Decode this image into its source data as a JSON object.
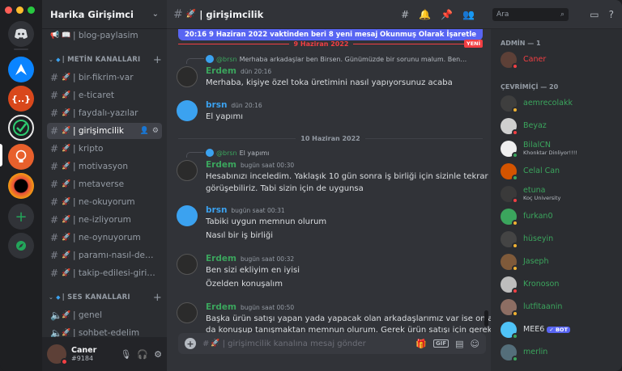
{
  "colors": {
    "accent": "#5865f2",
    "online": "#3ba55d",
    "dnd": "#f23f43",
    "idle": "#f0b232"
  },
  "guild": {
    "name": "Harika Girişimci"
  },
  "sidebar": {
    "top_channel": "| blog-paylasim",
    "text_category": "| METİN KANALLARI",
    "text_channels": [
      {
        "name": "| bir-fikrim-var"
      },
      {
        "name": "| e-ticaret"
      },
      {
        "name": "| faydalı-yazılar"
      },
      {
        "name": "| girişimcilik"
      },
      {
        "name": "| kripto"
      },
      {
        "name": "| motivasyon"
      },
      {
        "name": "| metaverse"
      },
      {
        "name": "| ne-okuyorum"
      },
      {
        "name": "| ne-izliyorum"
      },
      {
        "name": "| ne-oynuyorum"
      },
      {
        "name": "| paramı-nasıl-değe…"
      },
      {
        "name": "| takip-edilesi-girişi…"
      }
    ],
    "voice_category": "| SES KANALLARI",
    "voice_channels": [
      {
        "name": "| genel"
      },
      {
        "name": "| sohbet-edelim"
      }
    ]
  },
  "user": {
    "name": "Caner",
    "tag": "#9184"
  },
  "header": {
    "channel": "| girişimcilik",
    "search_placeholder": "Ara"
  },
  "new_messages": {
    "text": "20:16 9 Haziran 2022 vaktinden beri 8 yeni mesaj",
    "action": "Okunmuş Olarak İşaretle"
  },
  "dividers": {
    "first": "9 Haziran 2022",
    "second": "10 Haziran 2022",
    "new_label": "YENİ"
  },
  "messages": [
    {
      "reply_author": "@brsn",
      "reply_text": "Merhaba arkadaşlar ben Birsen. Günümüzde bir sorunu malum. Ben…",
      "author": "Erdem",
      "time": "dün 20:16",
      "lines": [
        "Merhaba, kişiye özel toka üretimini nasıl yapıyorsunuz acaba"
      ]
    },
    {
      "author": "brsn",
      "time": "dün 20:16",
      "lines": [
        "El yapımı"
      ]
    },
    {
      "reply_author": "@brsn",
      "reply_text": "El yapımı",
      "author": "Erdem",
      "time": "bugün saat 00:30",
      "lines": [
        "Hesabınızı inceledim. Yaklaşık 10 gün sonra iş birliği için sizinle tekrar",
        "görüşebiliriz. Tabi sizin için de uygunsa"
      ]
    },
    {
      "author": "brsn",
      "time": "bugün saat 00:31",
      "lines": [
        "Tabiki uygun memnun olurum",
        "Nasıl bir iş birliği"
      ]
    },
    {
      "author": "Erdem",
      "time": "bugün saat 00:32",
      "lines": [
        "Ben sizi ekliyim en iyisi",
        "Özelden konuşalım"
      ]
    },
    {
      "author": "Erdem",
      "time": "bugün saat 00:50",
      "lines": [
        "Başka ürün satışı yapan yada yapacak olan arkadaşlarımız var ise onlarla",
        "da konuşup tanışmaktan memnun olurum. Gerek ürün satışı için gerekse"
      ]
    }
  ],
  "composer": {
    "placeholder": "| girişimcilik kanalına mesaj gönder",
    "gif": "GIF"
  },
  "members": {
    "admin_header": "ADMİN — 1",
    "online_header": "ÇEVRİMİÇİ — 20",
    "admins": [
      {
        "name": "Caner"
      }
    ],
    "online": [
      {
        "name": "aemrecolakk"
      },
      {
        "name": "Beyaz"
      },
      {
        "name": "BilalCN",
        "status": "Khonktar Dinliyor!!!!"
      },
      {
        "name": "Celal Can"
      },
      {
        "name": "etuna",
        "status": "Koç University"
      },
      {
        "name": "furkan0"
      },
      {
        "name": "hüseyin"
      },
      {
        "name": "Jaseph"
      },
      {
        "name": "Kronoson"
      },
      {
        "name": "lutfitaanin"
      },
      {
        "name": "MEE6",
        "badge": "✓ BOT"
      },
      {
        "name": "merlin"
      }
    ]
  }
}
